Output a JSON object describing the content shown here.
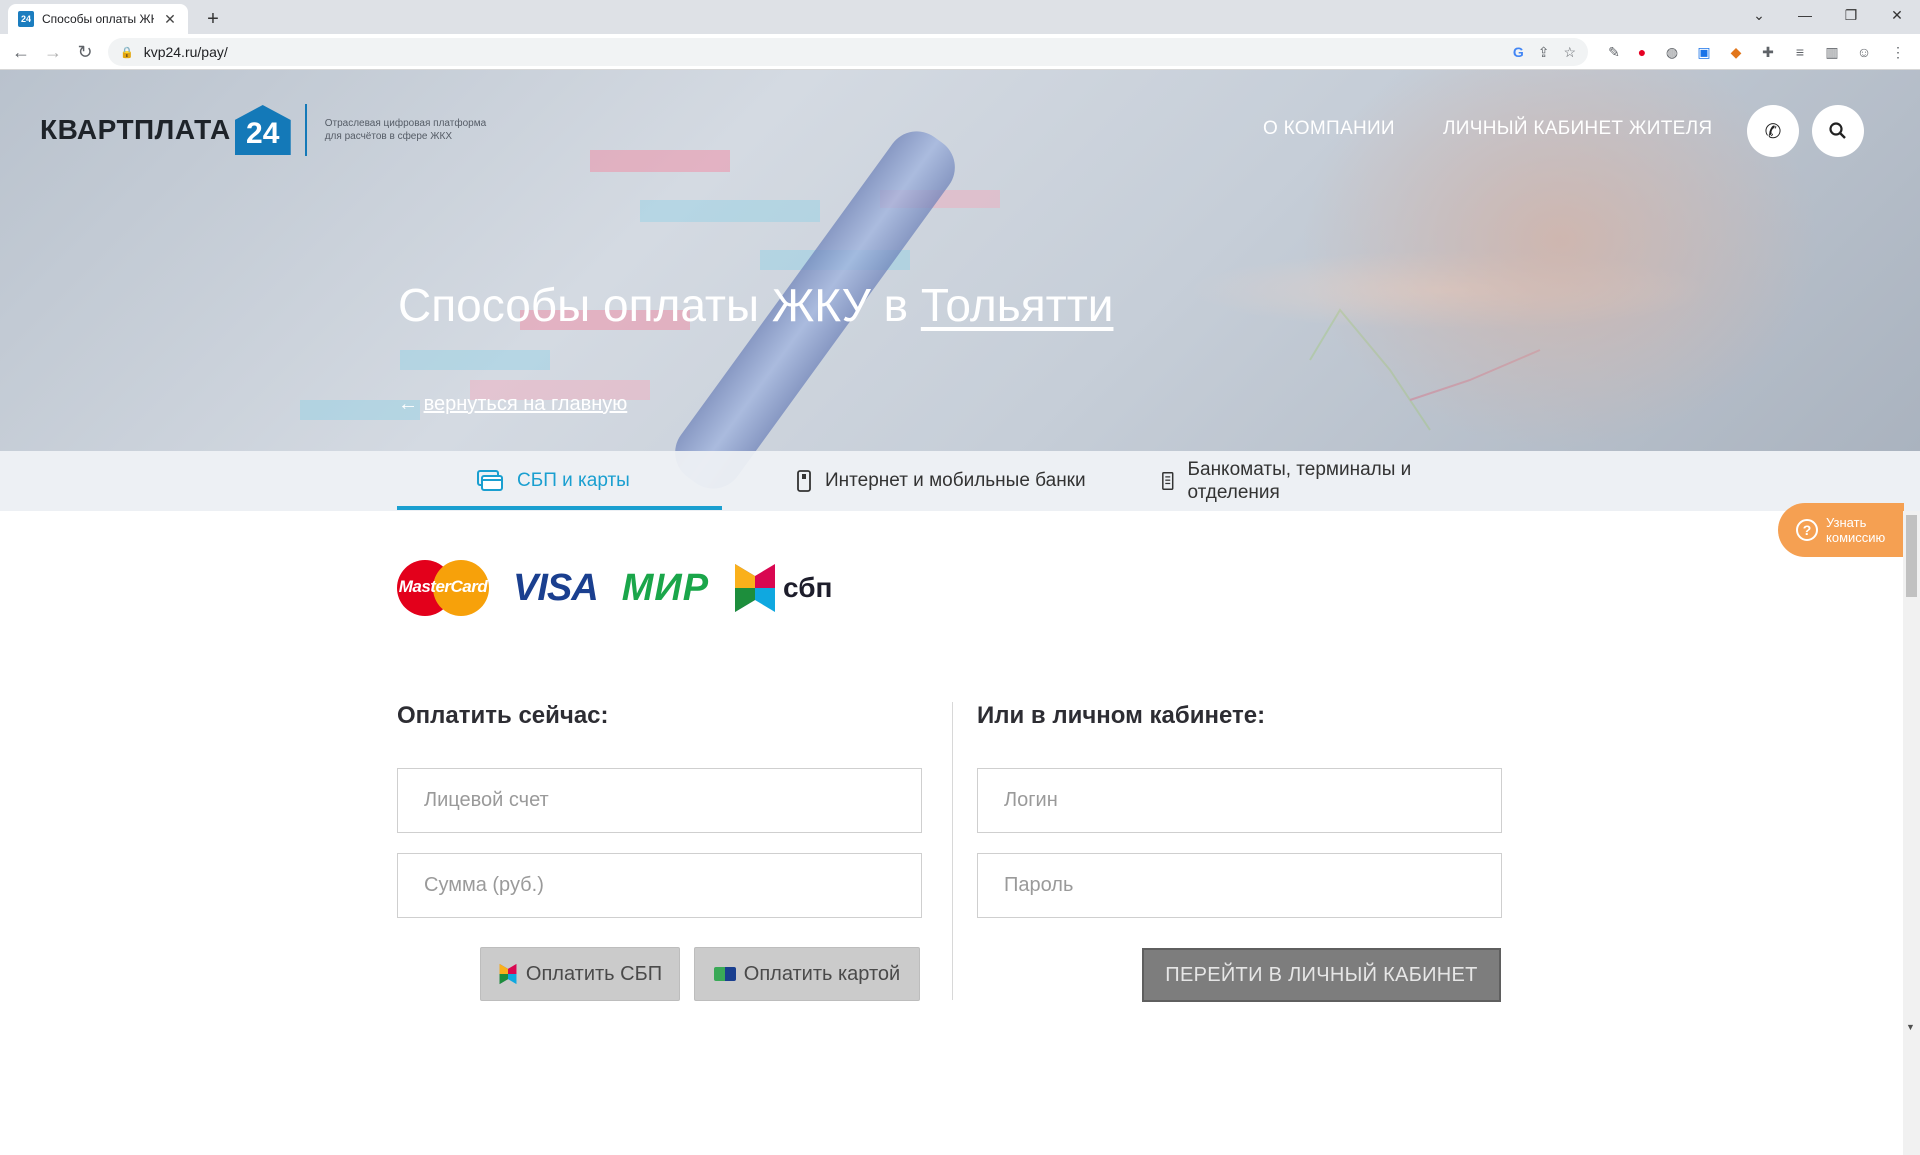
{
  "browser": {
    "tab_title": "Способы оплаты ЖКУ",
    "tab_favicon": "24",
    "url": "kvp24.ru/pay/",
    "new_tab": "+",
    "close_tab": "✕"
  },
  "header": {
    "logo_text": "КВАРТПЛАТА",
    "logo_number": "24",
    "logo_tagline": "Отраслевая цифровая платформа для расчётов в сфере ЖКХ",
    "nav": [
      "О КОМПАНИИ",
      "ЛИЧНЫЙ КАБИНЕТ ЖИТЕЛЯ"
    ]
  },
  "hero": {
    "title_prefix": "Способы оплаты ЖКУ в ",
    "city": "Тольятти",
    "back_arrow": "←",
    "back_link": "вернуться на главную"
  },
  "tabs": [
    {
      "label": "СБП и карты",
      "icon": "card-icon",
      "active": true
    },
    {
      "label": "Интернет и мобильные банки",
      "icon": "phone-icon",
      "active": false
    },
    {
      "label": "Банкоматы, терминалы и отделения",
      "icon": "atm-icon",
      "active": false
    }
  ],
  "payment_logos": {
    "mastercard": "MasterCard",
    "visa": "VISA",
    "mir": "МИР",
    "sbp": "сбп"
  },
  "fab": {
    "label": "Узнать комиссию",
    "icon": "question-icon",
    "color": "#f5a052"
  },
  "pay_now": {
    "title": "Оплатить сейчас:",
    "account_placeholder": "Лицевой счет",
    "sum_placeholder": "Сумма (руб.)",
    "sbp_button": "Оплатить СБП",
    "card_button": "Оплатить картой"
  },
  "cabinet": {
    "title": "Или в личном кабинете:",
    "login_placeholder": "Логин",
    "password_placeholder": "Пароль",
    "go_button": "ПЕРЕЙТИ В ЛИЧНЫЙ КАБИНЕТ"
  },
  "colors": {
    "accent": "#1a9fd0",
    "brand_blue": "#1479b8",
    "fab_orange": "#f5a052"
  }
}
